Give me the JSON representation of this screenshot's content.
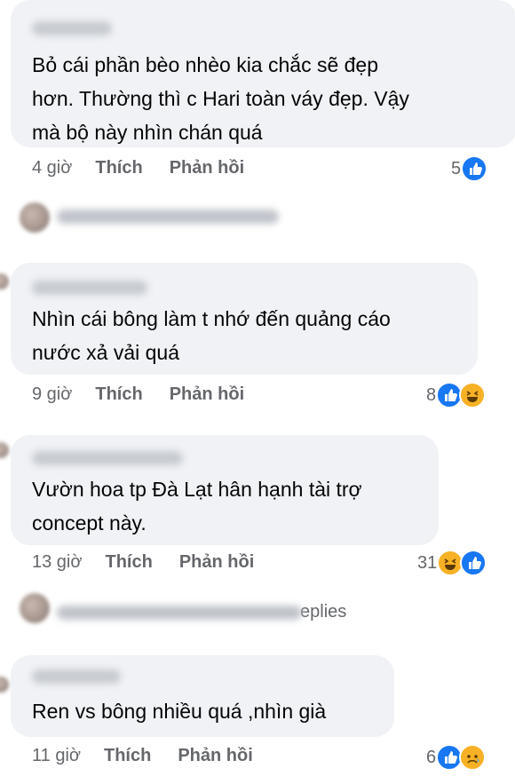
{
  "comments": [
    {
      "text_lines": [
        "Bỏ cái phần bèo nhèo kia chắc sẽ đẹp",
        "hơn. Thường thì c Hari toàn váy đẹp. Vậy",
        "mà bộ này nhìn chán quá"
      ],
      "time": "4 giờ",
      "like": "Thích",
      "reply": "Phản hồi",
      "reaction_count": "5",
      "reactions": [
        "like-icon"
      ]
    },
    {
      "text_lines": [
        "Nhìn cái bông làm t nhớ đến quảng cáo",
        "nước xả vải quá"
      ],
      "time": "9 giờ",
      "like": "Thích",
      "reply": "Phản hồi",
      "reaction_count": "8",
      "reactions": [
        "like-icon",
        "haha-icon"
      ]
    },
    {
      "text_lines": [
        "Vườn hoa tp Đà Lạt hân hạnh tài trợ",
        "concept này."
      ],
      "time": "13 giờ",
      "like": "Thích",
      "reply": "Phản hồi",
      "reaction_count": "31",
      "reactions": [
        "haha-icon",
        "like-icon"
      ]
    },
    {
      "text_lines": [
        "Ren vs bông nhiều quá ,nhìn già"
      ],
      "time": "11 giờ",
      "like": "Thích",
      "reply": "Phản hồi",
      "reaction_count": "6",
      "reactions": [
        "like-icon",
        "sad-icon"
      ]
    }
  ],
  "reply_rows": [
    {
      "text": ""
    },
    {
      "text": "eplies"
    }
  ],
  "colors": {
    "bubble": "#f0f2f5",
    "meta": "#65676b",
    "like": "#1877f2",
    "emoji": "#f7b125"
  }
}
